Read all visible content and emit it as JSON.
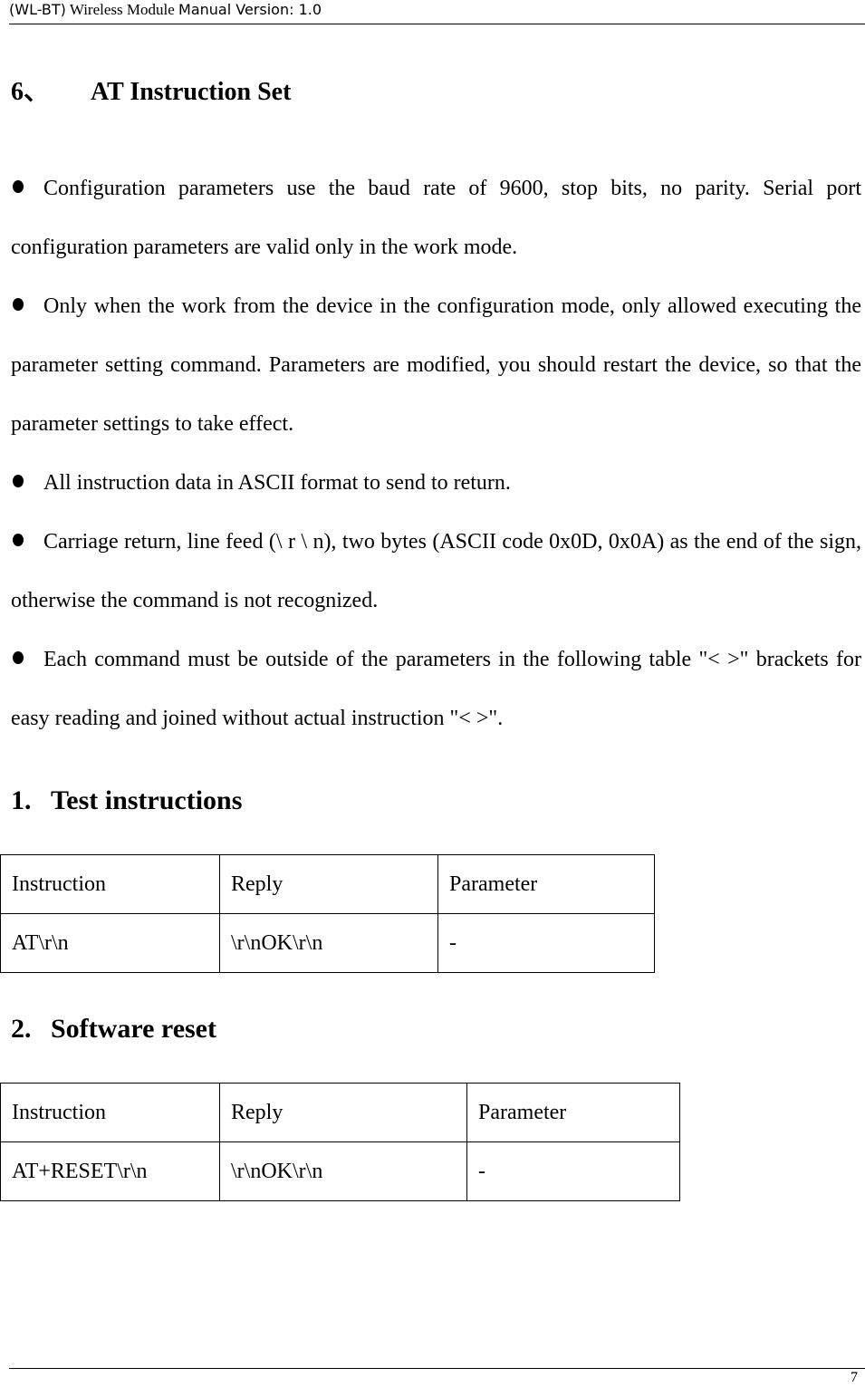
{
  "header": {
    "model": "(WL-BT)",
    "product": "Wireless Module",
    "manual": "Manual Version: 1.0"
  },
  "section": {
    "number": "6、",
    "title": "AT Instruction Set"
  },
  "bullets": [
    "Configuration parameters use the baud rate of 9600, stop bits, no parity. Serial port configuration parameters are valid only in the work mode.",
    "Only when the work from the device in the configuration mode, only allowed executing the parameter setting command. Parameters are modified, you should restart the device, so that the parameter settings to take effect.",
    "All instruction data in ASCII format to send to return.",
    "Carriage return, line feed (\\ r \\ n), two bytes (ASCII code 0x0D, 0x0A) as the end of the sign, otherwise the command is not recognized.",
    "Each command must be outside of the parameters in the following table \"< >\" brackets for easy reading and joined without actual instruction \"< >\"."
  ],
  "subsections": [
    {
      "number": "1.",
      "title": "Test instructions",
      "table": {
        "headers": [
          "Instruction",
          "Reply",
          "Parameter"
        ],
        "rows": [
          [
            "AT\\r\\n",
            "\\r\\nOK\\r\\n",
            "-"
          ]
        ]
      }
    },
    {
      "number": "2.",
      "title": "Software reset",
      "table": {
        "headers": [
          "Instruction",
          "Reply",
          "Parameter"
        ],
        "rows": [
          [
            "AT+RESET\\r\\n",
            "\\r\\nOK\\r\\n",
            "-"
          ]
        ]
      }
    }
  ],
  "footer": {
    "page_number": "7"
  }
}
